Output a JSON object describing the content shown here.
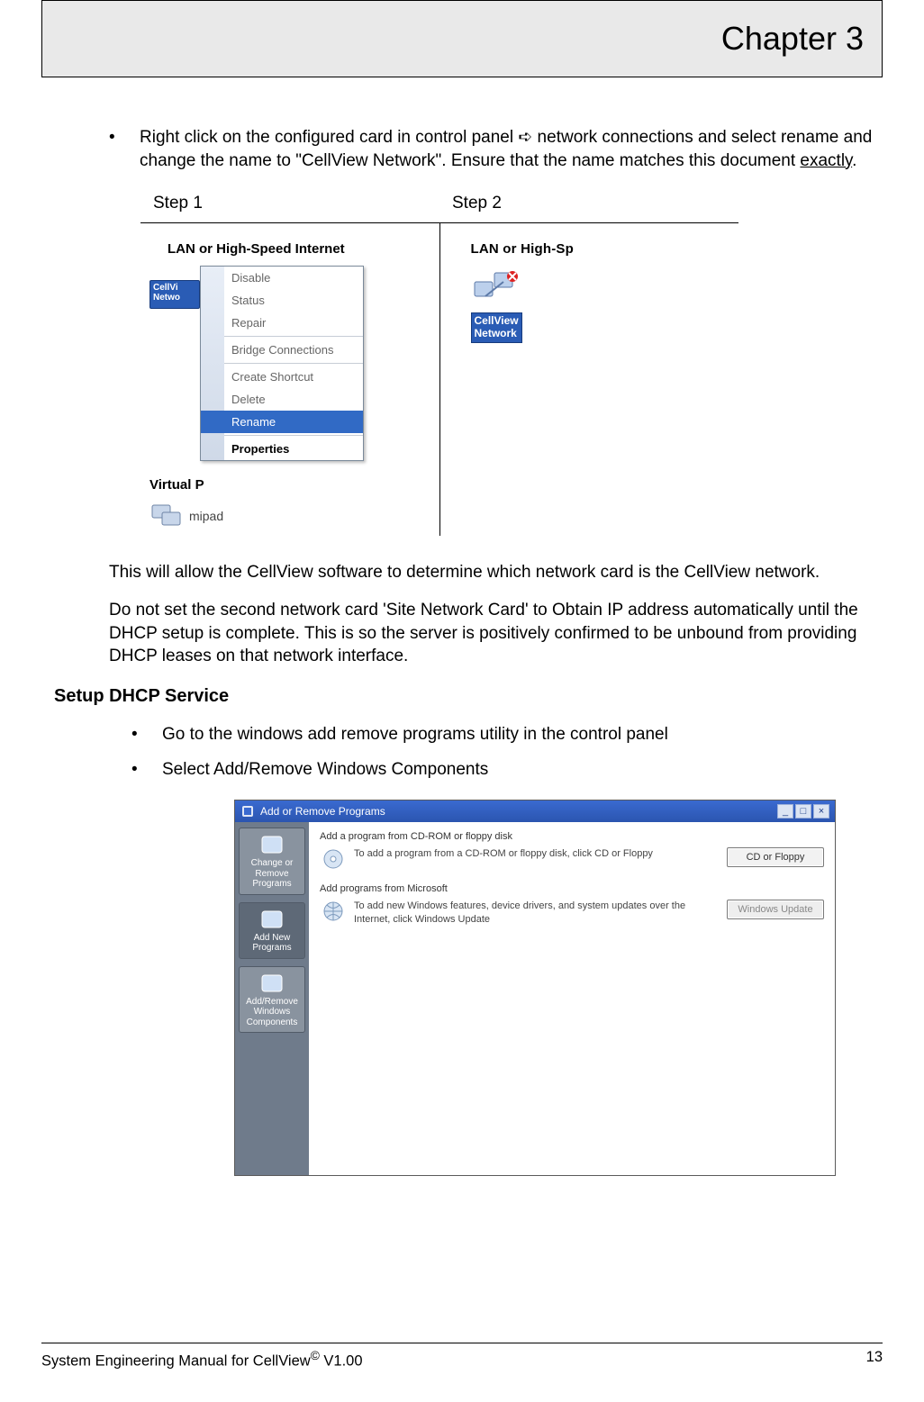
{
  "header": {
    "chapter": "Chapter 3"
  },
  "bullet1": {
    "pre": "Right click on the configured card in control panel ",
    "arrow": "➪",
    "mid": " network connections and select rename and change the name to \"CellView Network\". Ensure that the name matches this document ",
    "exactly": "exactly",
    "post": "."
  },
  "steps": {
    "col1": "Step 1",
    "col2": "Step 2"
  },
  "step1": {
    "lan_title": "LAN or High-Speed Internet",
    "conn_label_l1": "CellVi",
    "conn_label_l2": "Netwo",
    "virtual": "Virtual P",
    "mipad": "mipad",
    "menu": {
      "disable": "Disable",
      "status": "Status",
      "repair": "Repair",
      "bridge": "Bridge Connections",
      "shortcut": "Create Shortcut",
      "delete": "Delete",
      "rename": "Rename",
      "properties": "Properties"
    }
  },
  "step2": {
    "lan_title": "LAN or High-Sp",
    "label_l1": "CellView",
    "label_l2": "Network"
  },
  "para_allow": "This will allow the CellView software to determine which network card is the CellView network.",
  "para_dhcp": "Do not set the second network card 'Site Network Card' to Obtain IP address automatically until the DHCP setup is complete. This is so the server is positively confirmed to be unbound from providing DHCP leases on that network interface.",
  "h2_setup": "Setup DHCP Service",
  "bullet2a": "Go to the windows add remove programs utility in the control panel",
  "bullet2b": "Select Add/Remove Windows Components",
  "arp": {
    "title": "Add or Remove Programs",
    "side": {
      "change": "Change or Remove Programs",
      "addnew": "Add New Programs",
      "addrem": "Add/Remove Windows Components"
    },
    "sec1": {
      "head": "Add a program from CD-ROM or floppy disk",
      "text": "To add a program from a CD-ROM or floppy disk, click CD or Floppy",
      "btn": "CD or Floppy"
    },
    "sec2": {
      "head": "Add programs from Microsoft",
      "text": "To add new Windows features, device drivers, and system updates over the Internet, click Windows Update",
      "btn": "Windows Update"
    }
  },
  "footer": {
    "left_a": "System Engineering Manual for CellView",
    "left_b": " V1.00",
    "page": "13"
  }
}
